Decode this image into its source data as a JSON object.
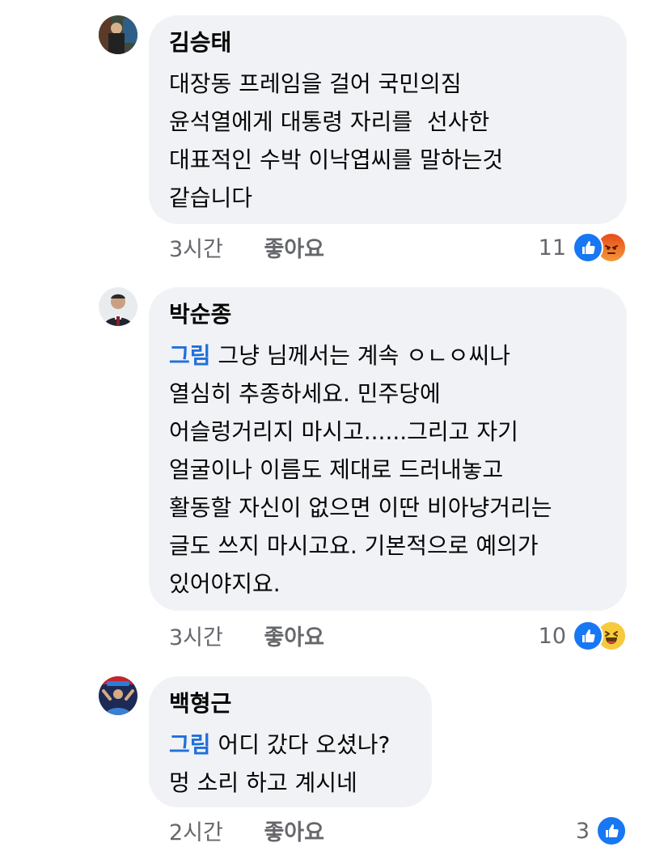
{
  "comments": [
    {
      "author": "김승태",
      "mention": "",
      "lines": [
        "대장동 프레임을 걸어 국민의짐",
        "윤석열에게 대통령 자리를  선사한",
        "대표적인 수박 이낙엽씨를 말하는것",
        "같습니다"
      ],
      "time": "3시간",
      "like_label": "좋아요",
      "reaction_count": "11",
      "reactions": [
        "like-icon",
        "angry-icon"
      ]
    },
    {
      "author": "박순종",
      "mention": "그림",
      "lines": [
        " 그냥 님께서는 계속 ㅇㄴㅇ씨나",
        "열심히 추종하세요. 민주당에",
        "어슬렁거리지 마시고......그리고 자기",
        "얼굴이나 이름도 제대로 드러내놓고",
        "활동할 자신이 없으면 이딴 비아냥거리는",
        "글도 쓰지 마시고요. 기본적으로 예의가",
        "있어야지요."
      ],
      "time": "3시간",
      "like_label": "좋아요",
      "reaction_count": "10",
      "reactions": [
        "like-icon",
        "haha-icon"
      ]
    },
    {
      "author": "백형근",
      "mention": "그림",
      "lines": [
        " 어디 갔다 오셨나?",
        "멍 소리 하고 계시네"
      ],
      "time": "2시간",
      "like_label": "좋아요",
      "reaction_count": "3",
      "reactions": [
        "like-icon"
      ]
    }
  ]
}
